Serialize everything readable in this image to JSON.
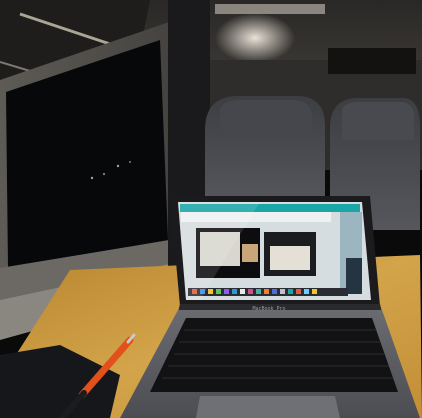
{
  "scene": {
    "description_tags": [
      "train-interior",
      "night-window",
      "laptop",
      "video-call",
      "pen",
      "tabletop"
    ],
    "led_sign_text": "",
    "laptop_brand_text": "MacBook Pro"
  },
  "colors": {
    "ceiling": "#3a3836",
    "window_dark": "#07080a",
    "seat": "#4b4d52",
    "tabletop": "#c99a3c",
    "laptop_body": "#5c5d62",
    "keyboard": "#121214",
    "screen_accent": "#1aa6a6",
    "led_amber": "#f0b030",
    "pen_orange": "#e2501c"
  }
}
